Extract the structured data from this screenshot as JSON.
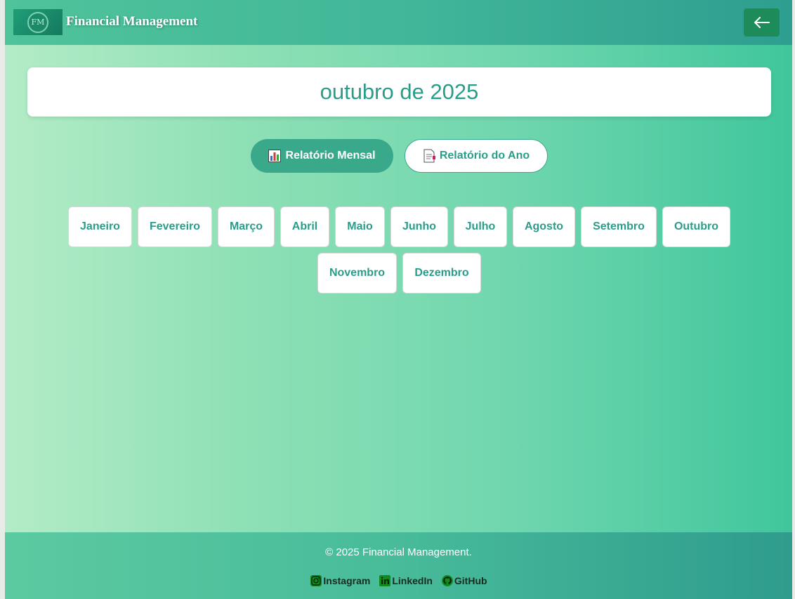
{
  "header": {
    "logo_text": "FM",
    "app_title": "Financial Management",
    "back_icon": "arrow-left-icon"
  },
  "main": {
    "current_month": "outubro de 2025",
    "report_buttons": {
      "monthly_label": "Relatório Mensal",
      "monthly_icon": "bar-chart-icon",
      "year_label": "Relatório do Ano",
      "year_icon": "document-icon"
    },
    "months": [
      "Janeiro",
      "Fevereiro",
      "Março",
      "Abril",
      "Maio",
      "Junho",
      "Julho",
      "Agosto",
      "Setembro",
      "Outubro",
      "Novembro",
      "Dezembro"
    ]
  },
  "footer": {
    "copyright": "© 2025 Financial Management.",
    "socials": [
      {
        "label": "Instagram",
        "icon": "instagram-icon"
      },
      {
        "label": "LinkedIn",
        "icon": "linkedin-icon"
      },
      {
        "label": "GitHub",
        "icon": "github-icon"
      }
    ]
  },
  "colors": {
    "accent": "#2a9d8a",
    "primary_button": "#3aa88a",
    "back_button": "#1e8c5a",
    "social_icon": "#128a1e"
  }
}
